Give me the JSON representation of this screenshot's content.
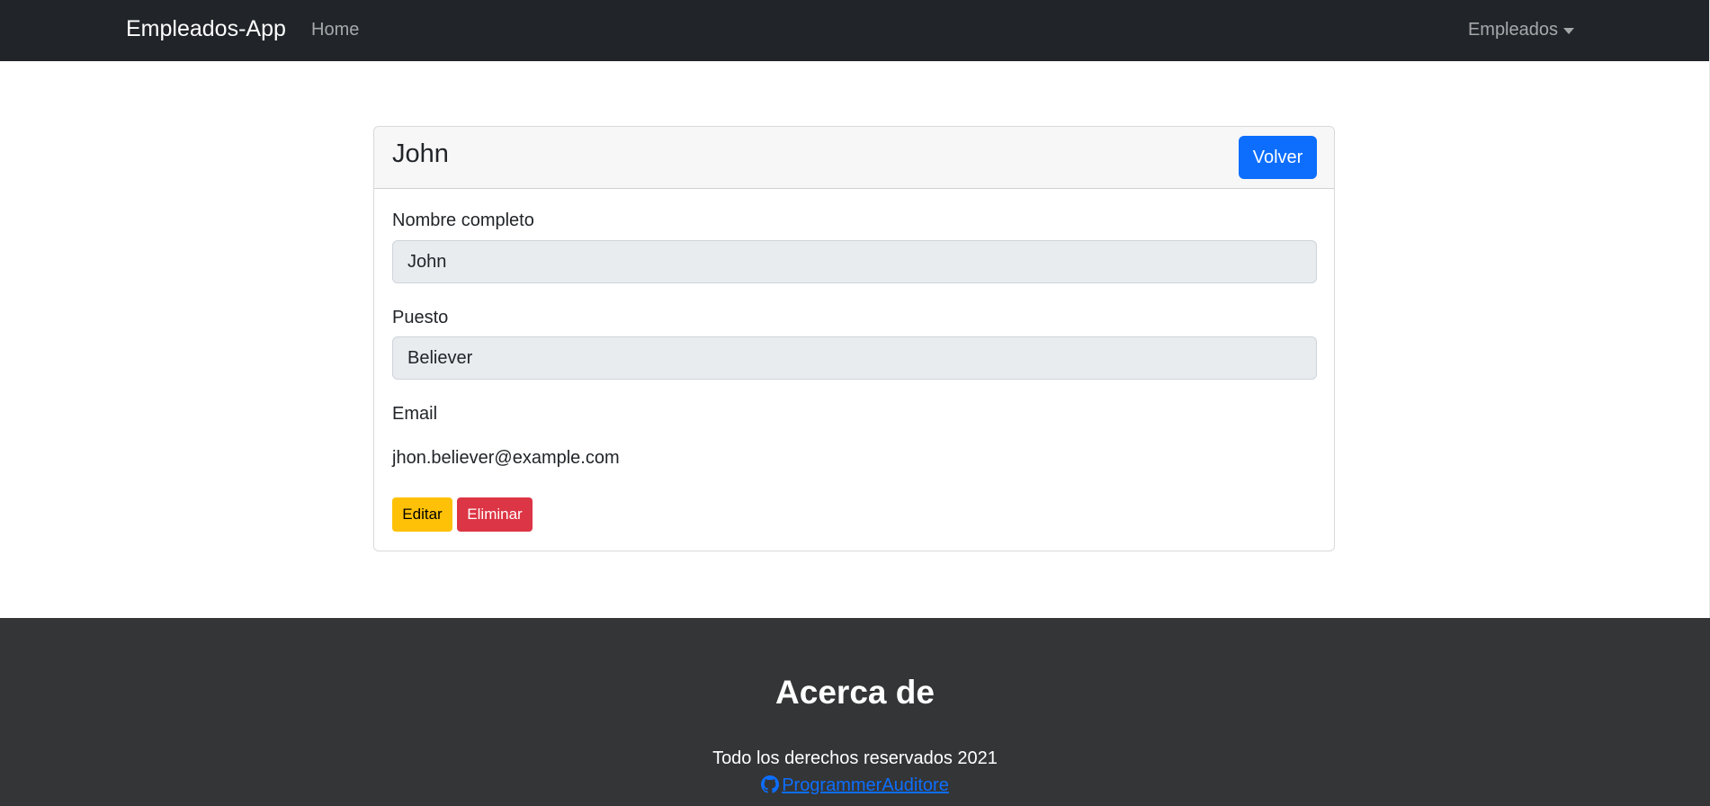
{
  "navbar": {
    "brand": "Empleados-App",
    "home": "Home",
    "dropdown": "Empleados"
  },
  "card": {
    "title": "John",
    "back_button": "Volver",
    "fields": {
      "name_label": "Nombre completo",
      "name_value": "John",
      "position_label": "Puesto",
      "position_value": "Believer",
      "email_label": "Email",
      "email_value": "jhon.believer@example.com"
    },
    "edit_button": "Editar",
    "delete_button": "Eliminar"
  },
  "footer": {
    "title": "Acerca de",
    "rights": "Todo los derechos reservados 2021",
    "link_text": "ProgrammerAuditore",
    "link_icon": "github-icon"
  },
  "colors": {
    "navbar_bg": "#212529",
    "primary": "#0d6efd",
    "warning": "#ffc107",
    "danger": "#dc3545",
    "footer_bg": "#343536"
  }
}
